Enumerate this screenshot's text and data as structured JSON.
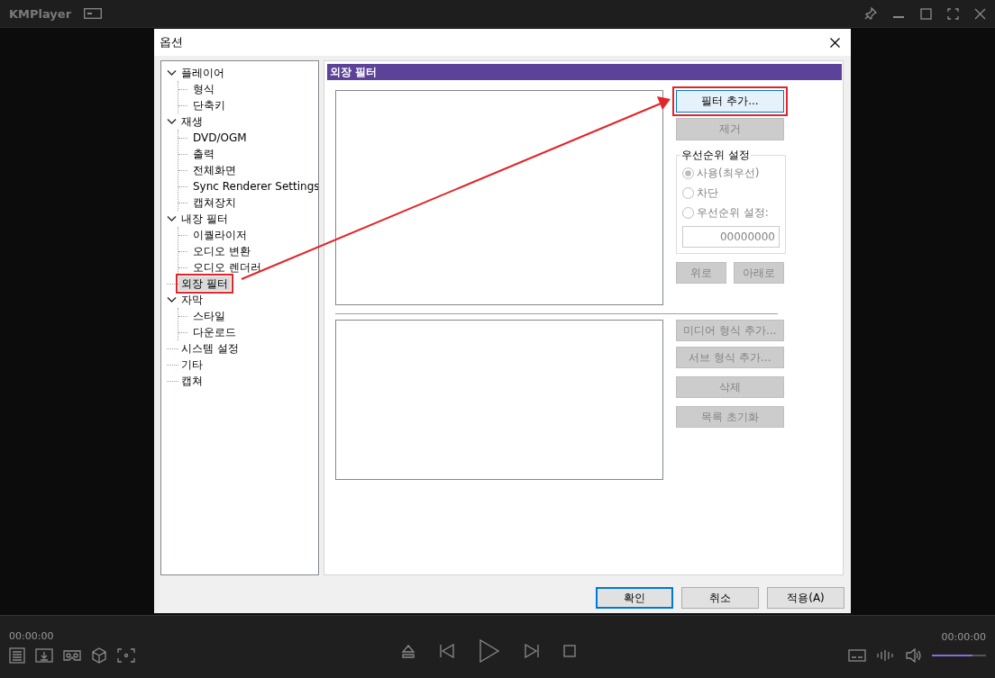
{
  "player": {
    "title": "KMPlayer",
    "time_elapsed": "00:00:00",
    "time_total": "00:00:00",
    "volume": {
      "level": 0.75
    }
  },
  "dialog": {
    "title": "옵션",
    "tree": [
      {
        "label": "플레이어",
        "expanded": true,
        "selected": false,
        "highlighted": false,
        "children": [
          {
            "label": "형식",
            "selected": false,
            "highlighted": false
          },
          {
            "label": "단축키",
            "selected": false,
            "highlighted": false
          }
        ]
      },
      {
        "label": "재생",
        "expanded": true,
        "selected": false,
        "highlighted": false,
        "children": [
          {
            "label": "DVD/OGM",
            "selected": false,
            "highlighted": false
          },
          {
            "label": "출력",
            "selected": false,
            "highlighted": false
          },
          {
            "label": "전체화면",
            "selected": false,
            "highlighted": false
          },
          {
            "label": "Sync Renderer Settings",
            "selected": false,
            "highlighted": false
          },
          {
            "label": "캡쳐장치",
            "selected": false,
            "highlighted": false
          }
        ]
      },
      {
        "label": "내장 필터",
        "expanded": true,
        "selected": false,
        "highlighted": false,
        "children": [
          {
            "label": "이퀄라이저",
            "selected": false,
            "highlighted": false
          },
          {
            "label": "오디오 변환",
            "selected": false,
            "highlighted": false
          },
          {
            "label": "오디오 렌더러",
            "selected": false,
            "highlighted": false
          }
        ]
      },
      {
        "label": "외장 필터",
        "selected": true,
        "highlighted": true
      },
      {
        "label": "자막",
        "expanded": true,
        "selected": false,
        "highlighted": false,
        "children": [
          {
            "label": "스타일",
            "selected": false,
            "highlighted": false
          },
          {
            "label": "다운로드",
            "selected": false,
            "highlighted": false
          }
        ]
      },
      {
        "label": "시스템 설정",
        "selected": false,
        "highlighted": false
      },
      {
        "label": "기타",
        "selected": false,
        "highlighted": false
      },
      {
        "label": "캡쳐",
        "selected": false,
        "highlighted": false
      }
    ],
    "panel": {
      "header": "외장 필터",
      "filter_buttons": [
        {
          "label": "필터 추가...",
          "disabled": false,
          "highlighted": true
        },
        {
          "label": "제거",
          "disabled": true,
          "highlighted": false
        }
      ],
      "priority": {
        "legend": "우선순위 설정",
        "options": [
          {
            "label": "사용(최우선)",
            "selected": true,
            "disabled": true
          },
          {
            "label": "차단",
            "selected": false,
            "disabled": true
          },
          {
            "label": "우선순위 설정:",
            "selected": false,
            "disabled": true
          }
        ],
        "value": "00000000"
      },
      "move_buttons": [
        {
          "label": "위로",
          "disabled": true
        },
        {
          "label": "아래로",
          "disabled": true
        }
      ],
      "type_buttons": [
        {
          "label": "미디어 형식 추가...",
          "disabled": true
        },
        {
          "label": "서브 형식 추가...",
          "disabled": true
        },
        {
          "label": "삭제",
          "disabled": true
        },
        {
          "label": "목록 초기화",
          "disabled": true
        }
      ]
    },
    "buttons": [
      {
        "label": "확인",
        "default": true
      },
      {
        "label": "취소",
        "default": false
      },
      {
        "label": "적용(A)",
        "default": false
      }
    ]
  }
}
